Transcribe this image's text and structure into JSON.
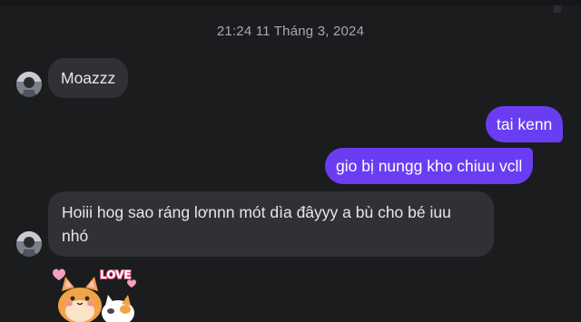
{
  "conversation": {
    "timestamp": "21:24 11 Tháng 3, 2024",
    "messages": [
      {
        "direction": "incoming",
        "text": "Moazzz"
      },
      {
        "direction": "outgoing",
        "text": "tai kenn"
      },
      {
        "direction": "outgoing",
        "text": "gio bị nungg kho chiuu vcll"
      },
      {
        "direction": "incoming",
        "text": "Hoiii hog sao ráng lơnnn mót dìa đâyyy a bù cho bé iuu nhó"
      }
    ],
    "sticker": {
      "text": "LOVE",
      "icon": "cat-love-sticker"
    }
  },
  "colors": {
    "background": "#1b1c1e",
    "incoming_bubble": "#303134",
    "outgoing_bubble": "#6a3df2",
    "timestamp_text": "#a7a9ad"
  }
}
